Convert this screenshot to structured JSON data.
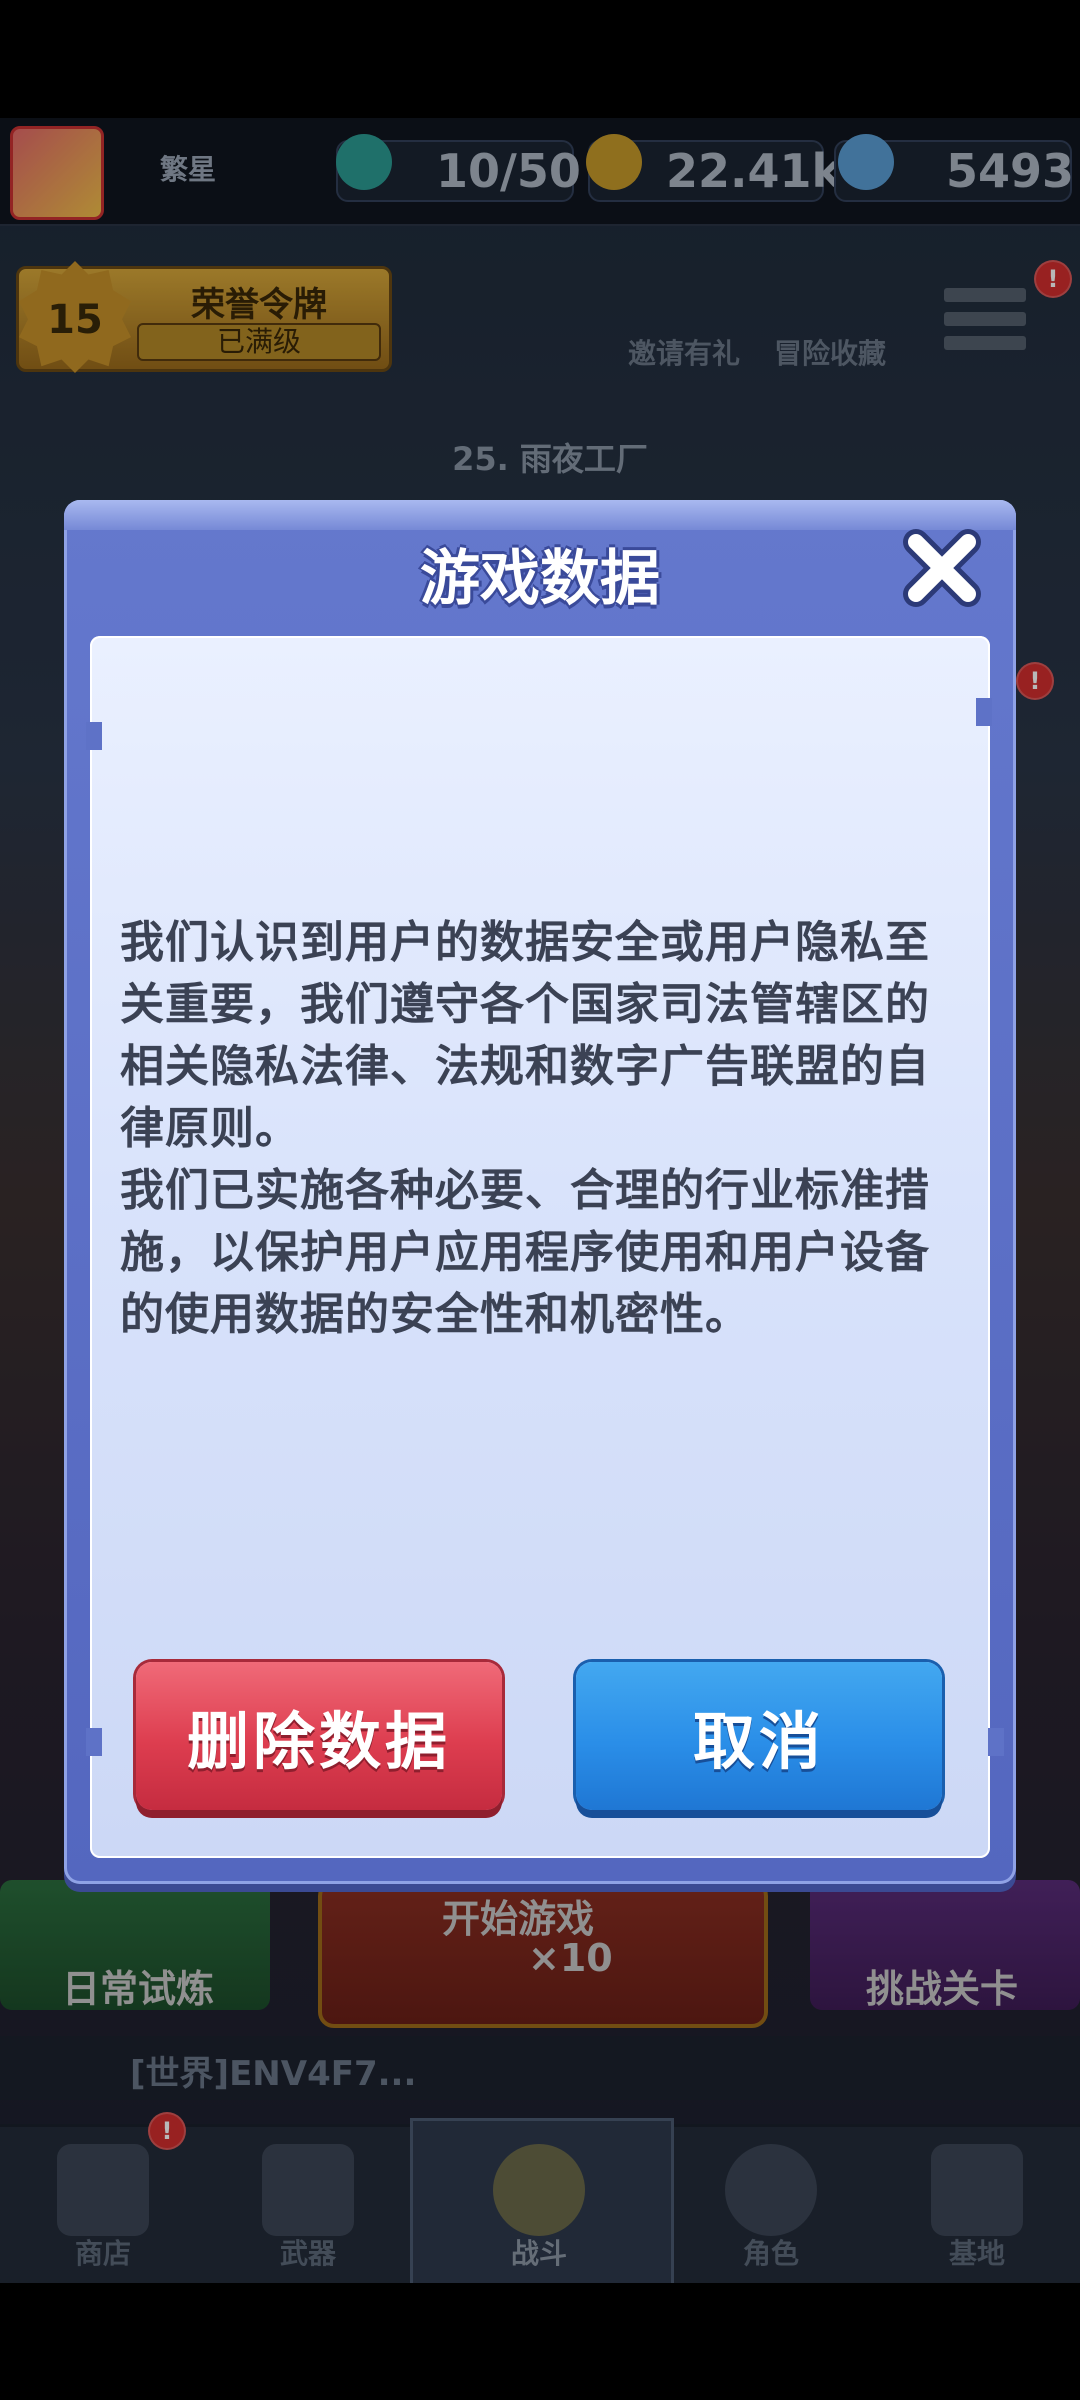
{
  "topbar": {
    "nickname": "繁星",
    "energy": "10/50",
    "coins": "22.41k",
    "gems": "5493"
  },
  "honor": {
    "level": "15",
    "title": "荣誉令牌",
    "status": "已满级"
  },
  "top_actions": {
    "invite_label": "邀请有礼",
    "collection_label": "冒险收藏"
  },
  "stage": {
    "title": "25. 雨夜工厂"
  },
  "bottom_actions": {
    "daily_label": "日常试炼",
    "start_label": "开始游戏",
    "start_cost": "×10",
    "challenge_label": "挑战关卡"
  },
  "chat": {
    "preview": "[世界]ENV4F7..."
  },
  "nav": {
    "shop": "商店",
    "weapons": "武器",
    "battle": "战斗",
    "character": "角色",
    "base": "基地"
  },
  "dialog": {
    "title": "游戏数据",
    "paragraph1": "我们认识到用户的数据安全或用户隐私至关重要，我们遵守各个国家司法管辖区的相关隐私法律、法规和数字广告联盟的自律原则。",
    "paragraph2": "我们已实施各种必要、合理的行业标准措施，以保护用户应用程序使用和用户设备的使用数据的安全性和机密性。",
    "delete_label": "删除数据",
    "cancel_label": "取消"
  },
  "colors": {
    "dialog_blue": "#5a6ec6",
    "delete_red": "#dd3d4f",
    "cancel_blue": "#2a8ee8"
  }
}
